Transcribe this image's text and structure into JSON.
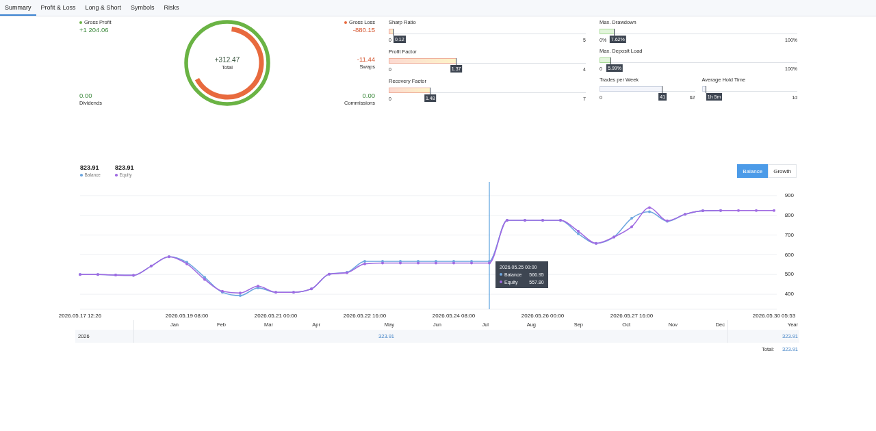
{
  "tabs": [
    {
      "label": "Summary",
      "selected": true
    },
    {
      "label": "Profit & Loss",
      "selected": false
    },
    {
      "label": "Long & Short",
      "selected": false
    },
    {
      "label": "Symbols",
      "selected": false
    },
    {
      "label": "Risks",
      "selected": false
    }
  ],
  "summary": {
    "left": [
      {
        "kind": "header",
        "label": "Gross Profit",
        "value": "+1 204.06",
        "negative": false,
        "color": "#6ab344"
      },
      {
        "kind": "stat",
        "label": "Dividends",
        "value": "0.00",
        "negative": false
      }
    ],
    "ring": {
      "value": "+312.47",
      "label": "Total",
      "level": 0.65
    },
    "right": [
      {
        "kind": "header",
        "label": "Gross Loss",
        "value": "-880.15",
        "negative": true,
        "color": "#e86a3e"
      },
      {
        "kind": "stat",
        "label": "Swaps",
        "value": "-11.44",
        "negative": true
      },
      {
        "kind": "stat",
        "label": "Commissions",
        "value": "0.00",
        "negative": false
      }
    ]
  },
  "metrics": {
    "ratios": [
      {
        "label": "Sharp Ratio",
        "kind": "ratio",
        "min": "0",
        "max": "5",
        "value": "0.12",
        "level": 0.024
      },
      {
        "label": "Profit Factor",
        "kind": "ratio",
        "min": "0",
        "max": "4",
        "value": "1.37",
        "level": 0.3425
      },
      {
        "label": "Recovery Factor",
        "kind": "ratio",
        "min": "0",
        "max": "7",
        "value": "1.48",
        "level": 0.211
      }
    ],
    "loads": [
      {
        "label": "Max. Drawdown",
        "kind": "percent",
        "min": "0%",
        "max": "100%",
        "value": "7.62%",
        "level": 0.0762
      },
      {
        "label": "Max. Deposit Load",
        "kind": "percent",
        "min": "0",
        "max": "100%",
        "value": "5.99%",
        "level": 0.0599
      }
    ],
    "activity": [
      {
        "label": "Trades per Week",
        "kind": "count",
        "min": "0",
        "max": "62",
        "value": "41",
        "level": 0.661
      },
      {
        "label": "Average Hold Time",
        "kind": "count",
        "max": "1d",
        "value": "1h 5m",
        "level": 0.045
      }
    ]
  },
  "chart": {
    "legend": [
      {
        "value": "823.91"
      },
      {
        "value": "823.91"
      }
    ],
    "modes": [
      {
        "label": "Balance",
        "selected": true
      },
      {
        "label": "Growth",
        "selected": false
      }
    ],
    "tooltip": {
      "title": "2026.05.25 00:00",
      "rows": [
        {
          "name": "Balance",
          "value": "566.95",
          "color": "#6ea7e0"
        },
        {
          "name": "Equity",
          "value": "557.80",
          "color": "#a06be2"
        }
      ]
    },
    "chart_data": {
      "type": "line",
      "grid": true,
      "categories": [
        "2026.05.17 12:26",
        null,
        null,
        null,
        null,
        null,
        "2026.05.19 08:00",
        null,
        null,
        null,
        null,
        "2026.05.21 00:00",
        null,
        null,
        null,
        null,
        "2026.05.22 16:00",
        null,
        null,
        null,
        null,
        "2026.05.24 08:00",
        null,
        null,
        null,
        null,
        "2026.05.26 00:00",
        null,
        null,
        null,
        null,
        "2026.05.27 16:00",
        null,
        null,
        null,
        null,
        null,
        null,
        null,
        "2026.05.30 05:53"
      ],
      "series": [
        {
          "name": "Balance",
          "color": "#6ea7e0",
          "values": [
            500,
            500,
            497,
            496,
            543,
            590,
            562,
            486,
            410,
            393,
            432,
            410,
            410,
            427,
            502,
            511,
            567,
            567,
            567,
            567,
            567,
            567,
            567,
            567,
            775,
            775,
            775,
            775,
            706,
            658,
            690,
            785,
            818,
            770,
            805,
            823,
            824,
            null,
            null,
            null
          ]
        },
        {
          "name": "Equity",
          "color": "#a06be2",
          "values": [
            500,
            500,
            497,
            496,
            543,
            590,
            554,
            475,
            415,
            406,
            441,
            410,
            410,
            427,
            502,
            509,
            554,
            558,
            558,
            558,
            558,
            558,
            558,
            558,
            775,
            775,
            775,
            775,
            719,
            658,
            690,
            742,
            839,
            772,
            805,
            823,
            824,
            824,
            824,
            824
          ]
        }
      ],
      "ylim": [
        324,
        969
      ],
      "yticks": [
        400,
        500,
        600,
        700,
        800,
        900
      ]
    }
  },
  "monthly_table": {
    "columns": [
      {
        "label": "Jan"
      },
      {
        "label": "Feb"
      },
      {
        "label": "Mar"
      },
      {
        "label": "Apr"
      },
      {
        "label": "May",
        "cells": [
          "323.91"
        ]
      },
      {
        "label": "Jun"
      },
      {
        "label": "Jul"
      },
      {
        "label": "Aug"
      },
      {
        "label": "Sep"
      },
      {
        "label": "Oct"
      },
      {
        "label": "Nov"
      },
      {
        "label": "Dec"
      }
    ],
    "year_column": {
      "label": "Year",
      "cells": [
        "323.91"
      ]
    },
    "rows": [
      {
        "year": "2026"
      }
    ],
    "total": {
      "label": "Total:",
      "value": "323.91"
    }
  }
}
